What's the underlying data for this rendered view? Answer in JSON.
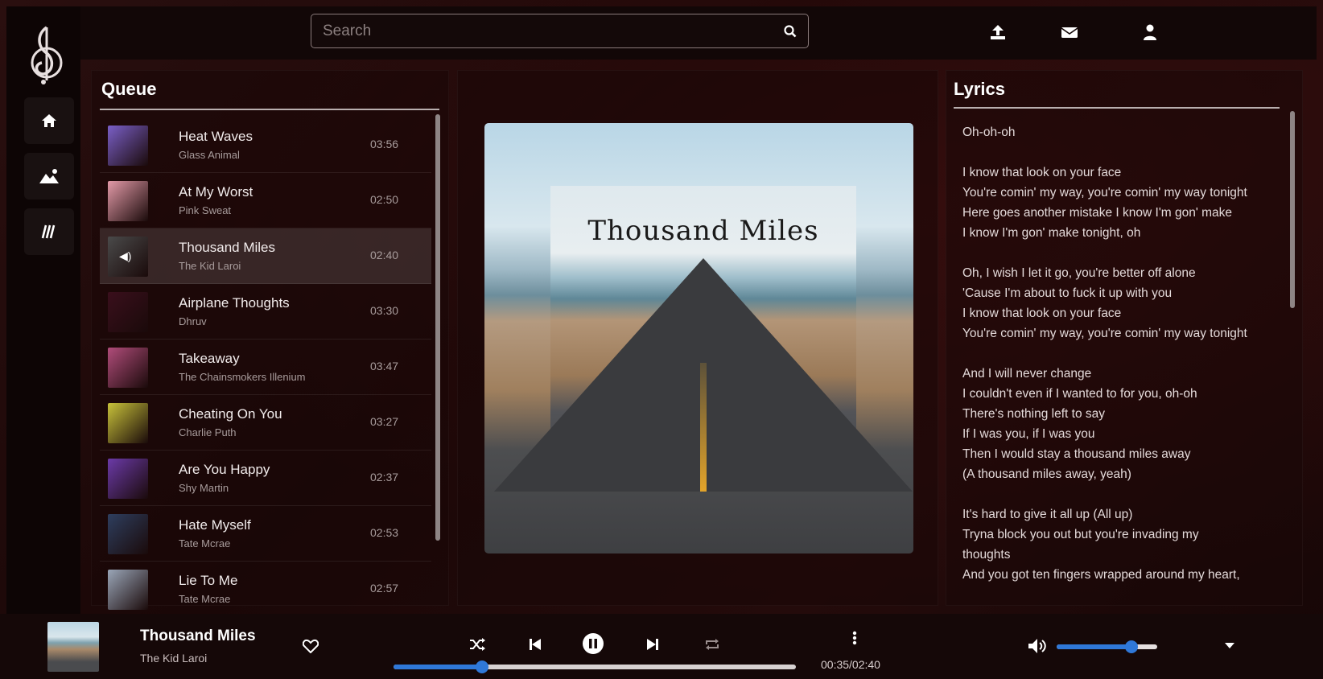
{
  "search": {
    "placeholder": "Search"
  },
  "queue": {
    "title": "Queue",
    "items": [
      {
        "title": "Heat Waves",
        "artist": "Glass Animal",
        "duration": "03:56",
        "color": "#7a5fc7"
      },
      {
        "title": "At My Worst",
        "artist": "Pink Sweat",
        "duration": "02:50",
        "color": "#e39aa8"
      },
      {
        "title": "Thousand Miles",
        "artist": "The Kid Laroi",
        "duration": "02:40",
        "color": "#4a4a4a"
      },
      {
        "title": "Airplane Thoughts",
        "artist": "Dhruv",
        "duration": "03:30",
        "color": "#3a0f1c"
      },
      {
        "title": "Takeaway",
        "artist": "The Chainsmokers Illenium",
        "duration": "03:47",
        "color": "#b04c7a"
      },
      {
        "title": "Cheating On You",
        "artist": "Charlie Puth",
        "duration": "03:27",
        "color": "#c8c23a"
      },
      {
        "title": "Are You Happy",
        "artist": "Shy Martin",
        "duration": "02:37",
        "color": "#6b3aa8"
      },
      {
        "title": "Hate Myself",
        "artist": "Tate Mcrae",
        "duration": "02:53",
        "color": "#2e3e5e"
      },
      {
        "title": "Lie To Me",
        "artist": "Tate Mcrae",
        "duration": "02:57",
        "color": "#9aa6b8"
      }
    ],
    "active_index": 2
  },
  "album": {
    "title": "Thousand Miles"
  },
  "lyrics": {
    "title": "Lyrics",
    "lines": [
      "Oh-oh-oh",
      "",
      "I know that look on your face",
      "You're comin' my way, you're comin' my way tonight",
      "Here goes another mistake I know I'm gon' make",
      "I know I'm gon' make tonight, oh",
      "",
      "Oh, I wish I let it go, you're better off alone",
      "'Cause I'm about to fuck it up with you",
      "I know that look on your face",
      "You're comin' my way, you're comin' my way tonight",
      "",
      "And I will never change",
      "I couldn't even if I wanted to for you, oh-oh",
      "There's nothing left to say",
      "If I was you, if I was you",
      "Then I would stay a thousand miles away",
      "(A thousand miles away, yeah)",
      "",
      "It's hard to give it all up (All up)",
      "Tryna block you out but you're invading my",
      "thoughts",
      "And you got ten fingers wrapped around my heart,"
    ]
  },
  "player": {
    "title": "Thousand Miles",
    "artist": "The Kid Laroi",
    "time": "00:35/02:40",
    "progress": 0.22,
    "volume": 0.74
  },
  "icons": {
    "logo": "treble-clef-logo",
    "home": "home-icon",
    "explore": "mountain-icon",
    "library": "library-icon",
    "upload": "upload-icon",
    "mail": "mail-icon",
    "user": "user-icon"
  },
  "colors": {
    "accent": "#2f78d8",
    "background": "#1a0707"
  }
}
